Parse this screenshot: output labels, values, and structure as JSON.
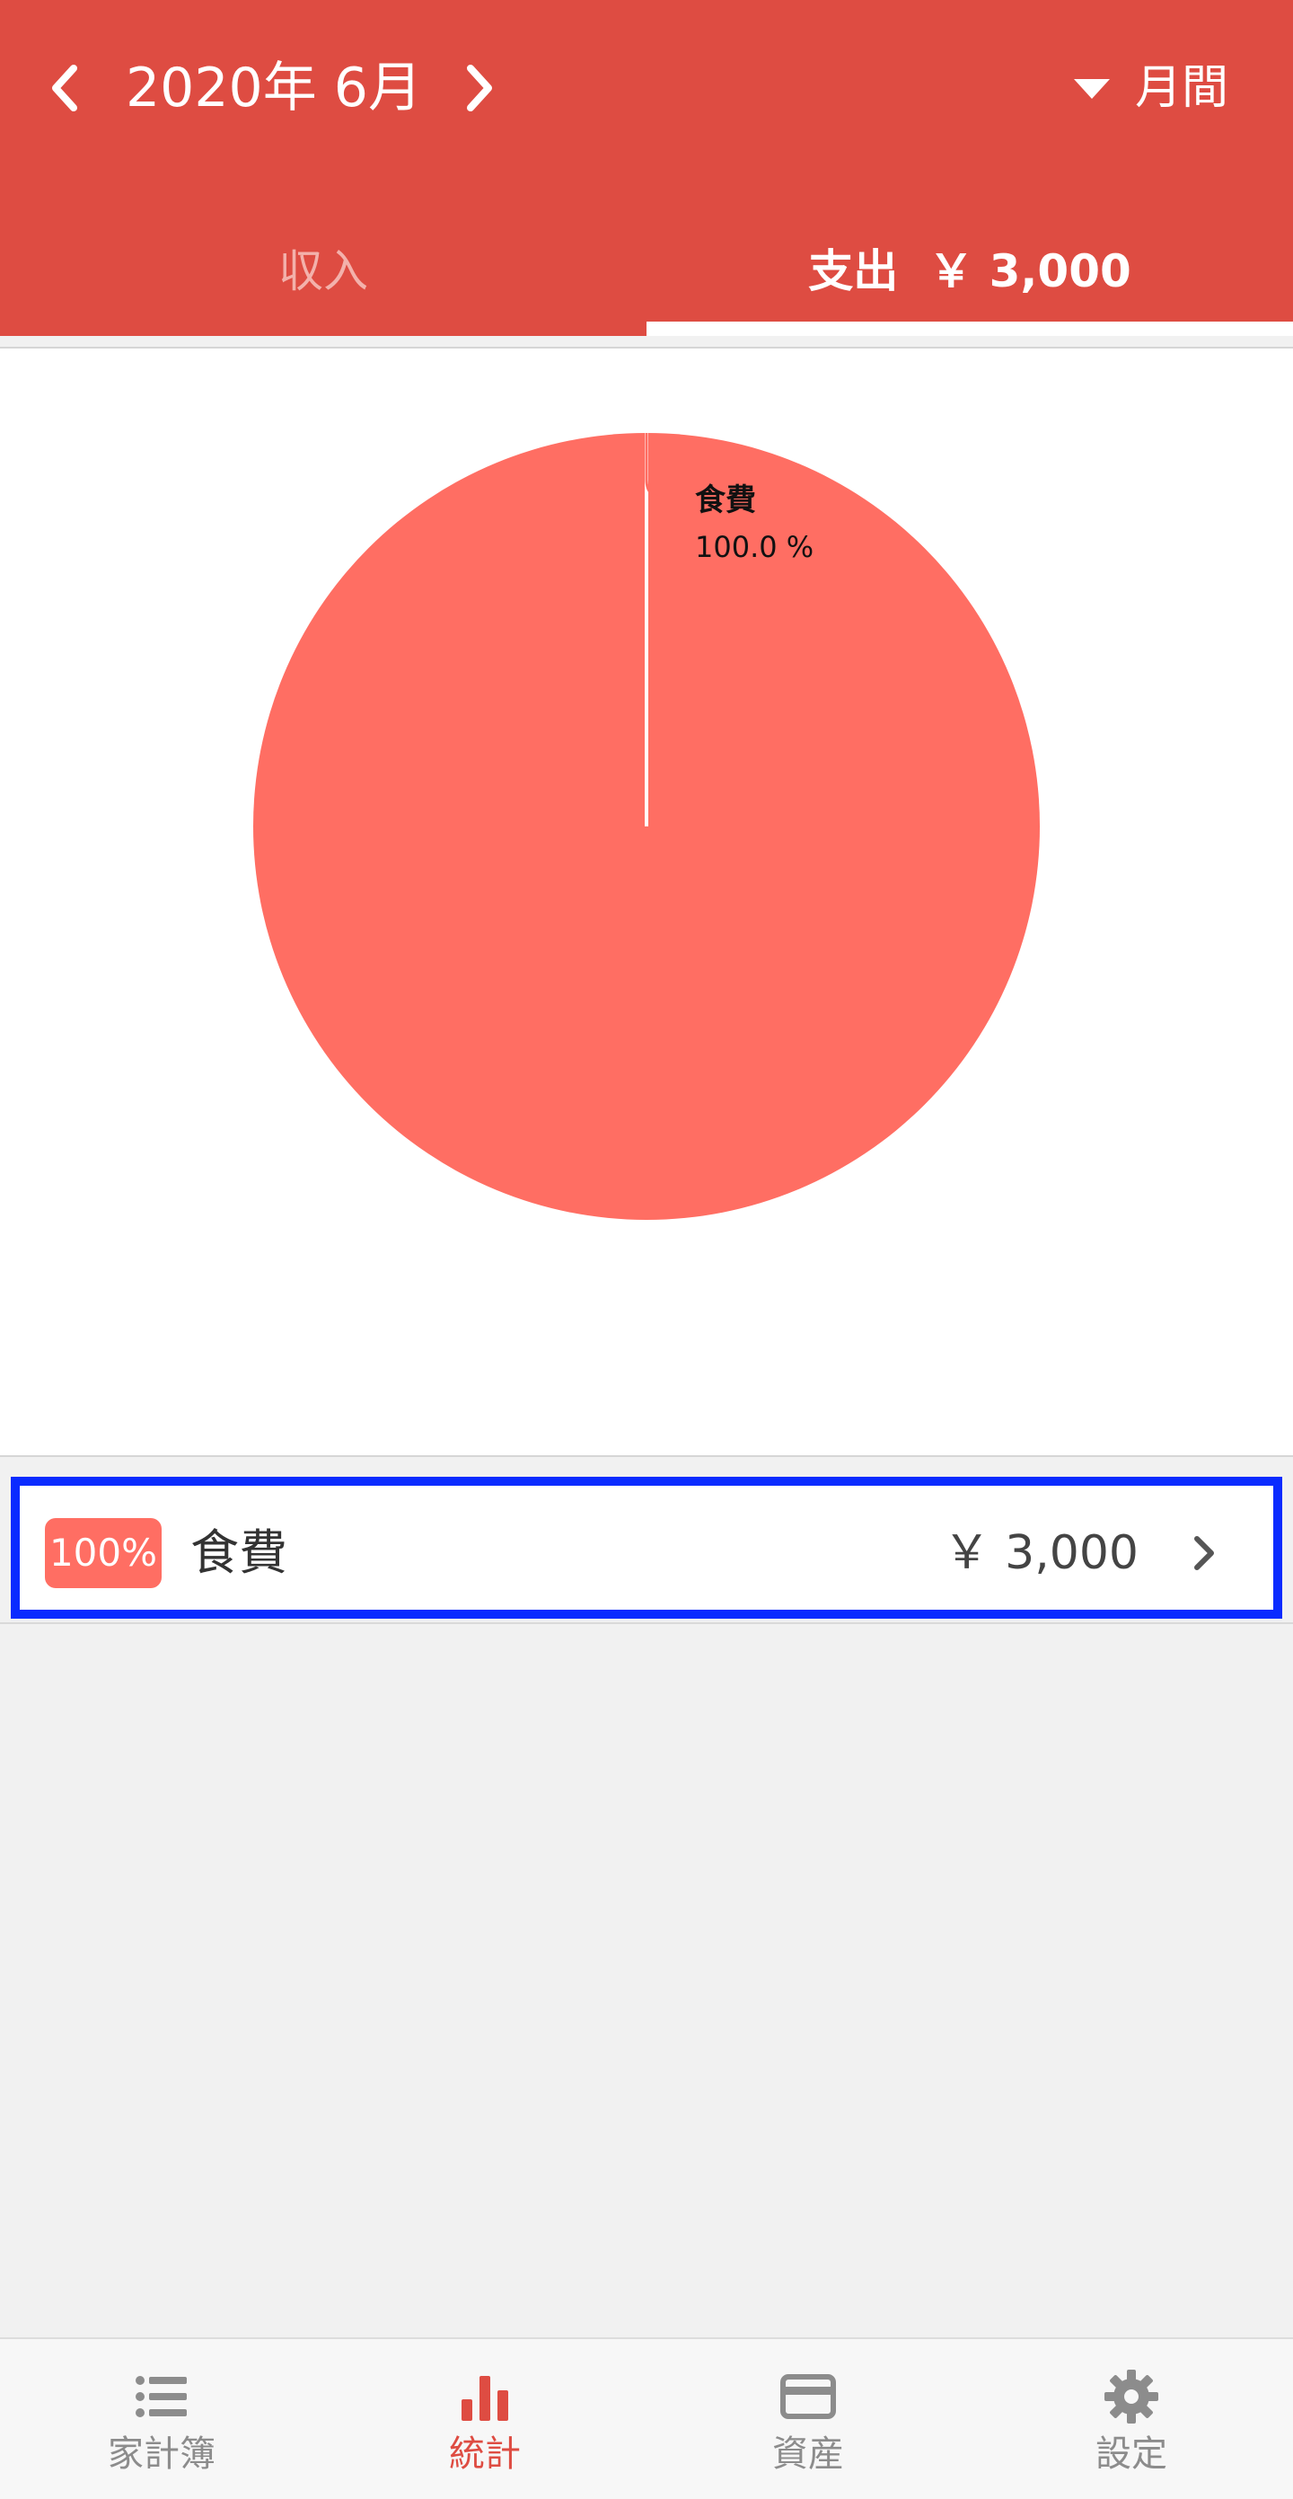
{
  "header": {
    "month_title": "2020年 6月",
    "period_label": "月間",
    "tabs": [
      {
        "label": "収入",
        "active": false
      },
      {
        "label": "支出",
        "amount": "￥ 3,000",
        "active": true
      }
    ]
  },
  "chart_data": {
    "type": "pie",
    "slices": [
      {
        "label": "食費",
        "value": 100.0,
        "percent_text": "100.0 %",
        "color": "#ff6e63"
      }
    ]
  },
  "categories": [
    {
      "percent": "100%",
      "name": "食費",
      "amount": "￥ 3,000"
    }
  ],
  "bottom_nav": [
    {
      "label": "家計簿",
      "icon": "list-icon",
      "active": false
    },
    {
      "label": "統計",
      "icon": "bar-chart-icon",
      "active": true
    },
    {
      "label": "資産",
      "icon": "credit-card-icon",
      "active": false
    },
    {
      "label": "設定",
      "icon": "gear-icon",
      "active": false
    }
  ],
  "colors": {
    "brand_red": "#de4c42",
    "pie_red": "#ff6e63",
    "highlight_blue": "#0a2bff",
    "inactive_gray": "#8c8c8c"
  }
}
